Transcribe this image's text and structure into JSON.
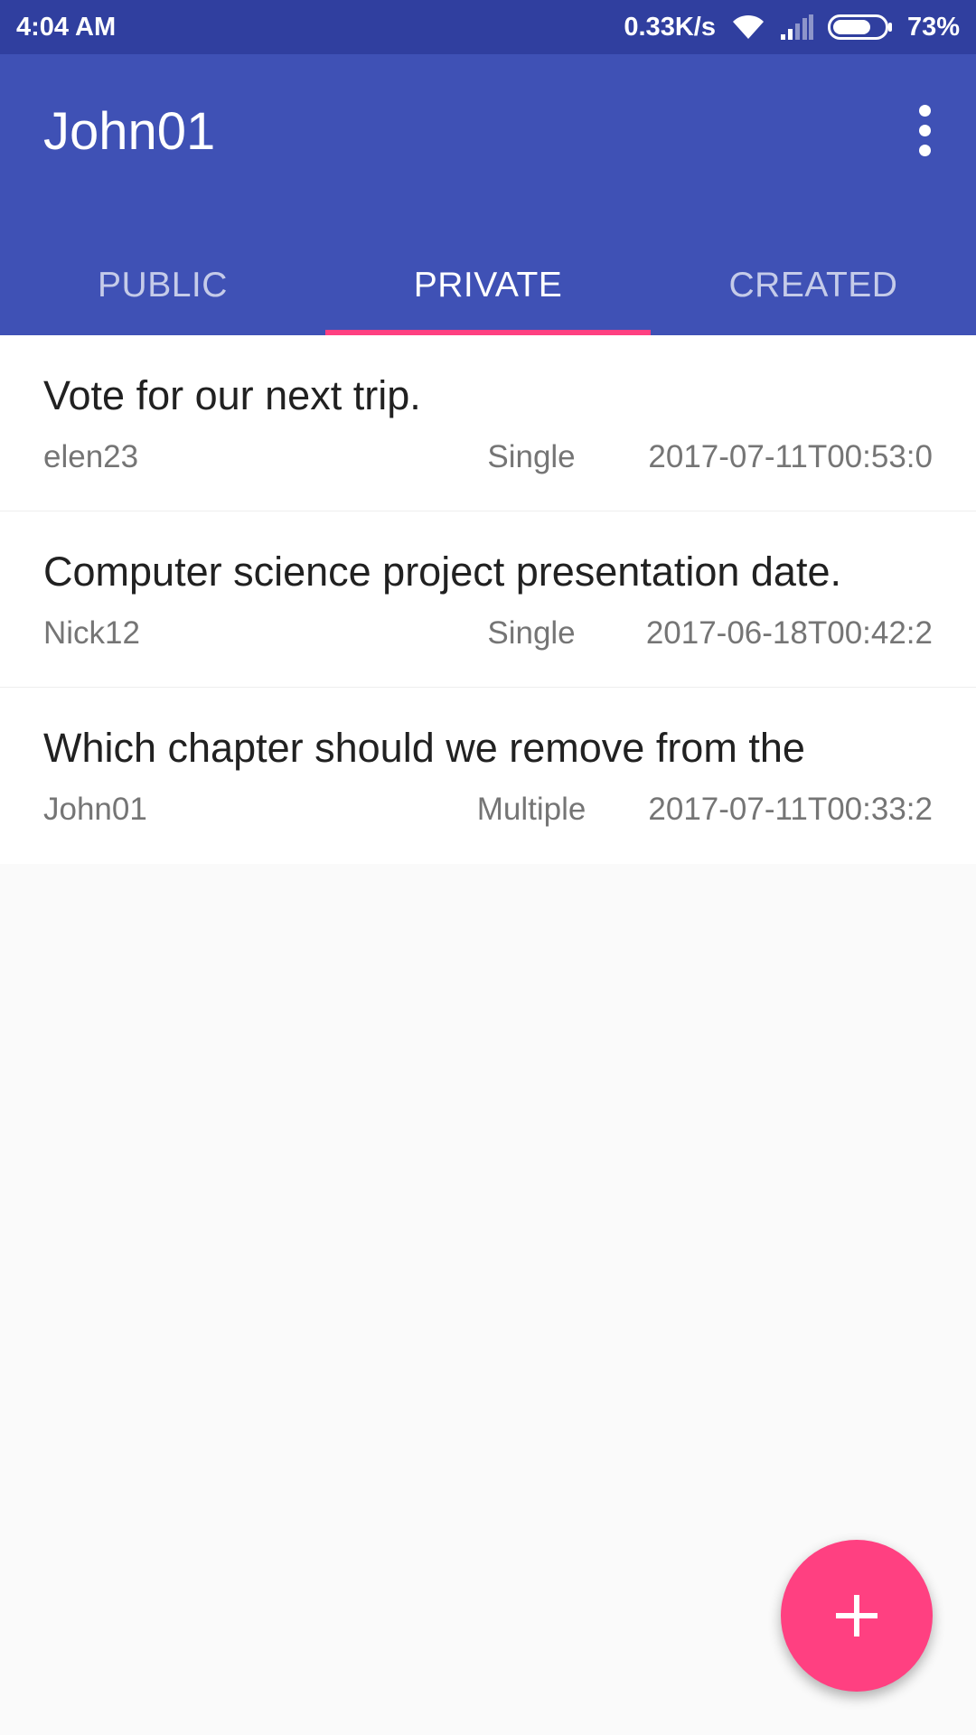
{
  "status_bar": {
    "time": "4:04 AM",
    "network_speed": "0.33K/s",
    "battery_percent": "73%",
    "battery_level": 0.73
  },
  "app_bar": {
    "title": "John01",
    "menu_icon": "more-vert-icon"
  },
  "tabs": [
    {
      "label": "PUBLIC",
      "active": false
    },
    {
      "label": "PRIVATE",
      "active": true
    },
    {
      "label": "CREATED",
      "active": false
    }
  ],
  "polls": [
    {
      "title": "Vote for our next trip.",
      "author": "elen23",
      "type": "Single",
      "date": "2017-07-11T00:53:0"
    },
    {
      "title": "Computer science project presentation date.",
      "author": "Nick12",
      "type": "Single",
      "date": "2017-06-18T00:42:2"
    },
    {
      "title": "Which chapter should we remove from the",
      "author": "John01",
      "type": "Multiple",
      "date": "2017-07-11T00:33:2"
    }
  ],
  "fab": {
    "icon": "plus-icon"
  },
  "colors": {
    "primary": "#3f51b5",
    "primary_dark": "#303f9f",
    "accent": "#ff4081"
  }
}
